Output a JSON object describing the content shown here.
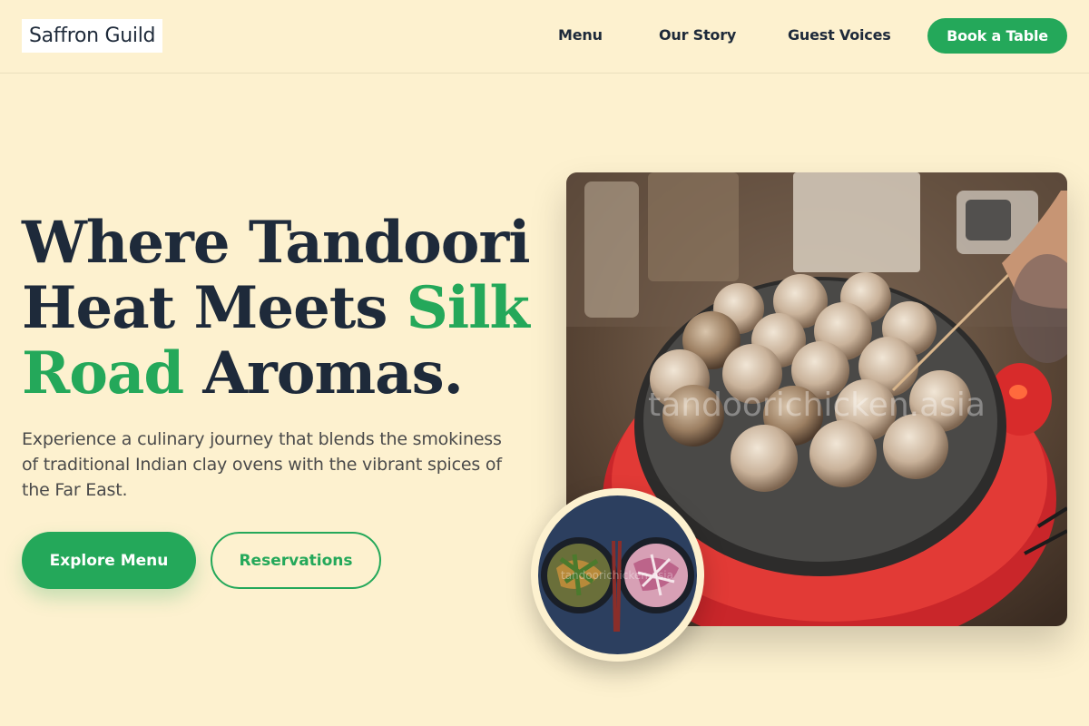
{
  "header": {
    "logo": "Saffron Guild",
    "nav": {
      "menu": "Menu",
      "story": "Our Story",
      "voices": "Guest Voices"
    },
    "cta": "Book a Table"
  },
  "hero": {
    "headline_part1": "Where Tandoori Heat Meets ",
    "headline_accent1": "Silk",
    "headline_accent2": "Road",
    "headline_part2": " Aromas.",
    "subtext": "Experience a culinary journey that blends the smokiness of traditional Indian clay ovens with the vibrant spices of the Far East.",
    "primary_button": "Explore Menu",
    "secondary_button": "Reservations"
  },
  "images": {
    "main_watermark": "tandoorichicken.asia",
    "badge_watermark": "tandoorichicken.asia"
  },
  "colors": {
    "background": "#fdf1cf",
    "accent": "#24a85a",
    "text": "#1e2a3a"
  }
}
